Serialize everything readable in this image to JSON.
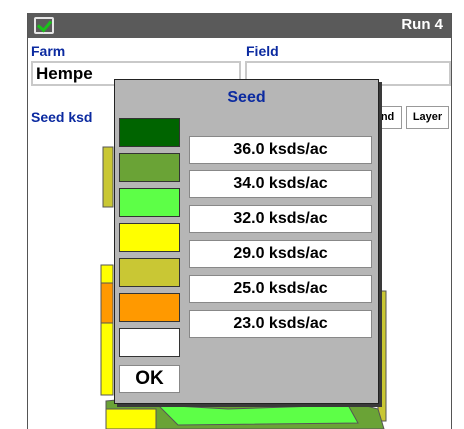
{
  "header": {
    "run_label": "Run 4",
    "app_icon": "checkmark-icon"
  },
  "farm": {
    "label": "Farm",
    "value": "Hempe"
  },
  "field": {
    "label": "Field",
    "value": ""
  },
  "seed": {
    "label": "Seed ksd"
  },
  "buttons": {
    "legend": "end",
    "layer": "Layer"
  },
  "dialog": {
    "title": "Seed",
    "ok_label": "OK",
    "items": [
      {
        "color": "#006400",
        "rate": "36.0 ksds/ac"
      },
      {
        "color": "#6aa336",
        "rate": "34.0 ksds/ac"
      },
      {
        "color": "#5dff47",
        "rate": "32.0 ksds/ac"
      },
      {
        "color": "#ffff00",
        "rate": "29.0 ksds/ac"
      },
      {
        "color": "#c9c734",
        "rate": "25.0 ksds/ac"
      },
      {
        "color": "#ff9900",
        "rate": "23.0 ksds/ac"
      },
      {
        "color": "#ffffff",
        "rate": ""
      }
    ]
  }
}
